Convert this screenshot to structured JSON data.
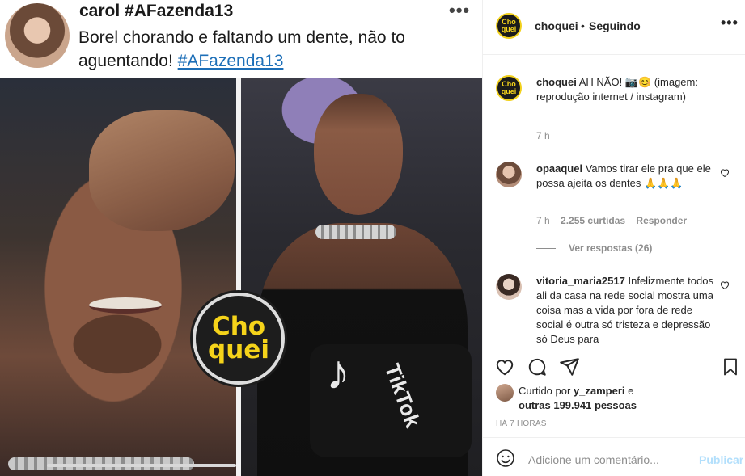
{
  "tweet": {
    "name": "carol #AFazenda13",
    "text": "Borel chorando e faltando um dente, não to aguentando!",
    "hashtag": "#AFazenda13",
    "more": "•••"
  },
  "media": {
    "logo_line1": "Cho",
    "logo_line2": "quei",
    "tiktok_word": "TikTok",
    "tiktok_mark": "♪",
    "video_progress": 1.0
  },
  "header": {
    "username": "choquei",
    "separator": "•",
    "follow_status": "Seguindo",
    "more": "•••",
    "avatar_line1": "Cho",
    "avatar_line2": "quei"
  },
  "caption": {
    "username": "choquei",
    "text": "AH NÃO! 📷😊 (imagem: reprodução internet / instagram)",
    "time": "7 h"
  },
  "comments": [
    {
      "username": "opaaquel",
      "text": "Vamos tirar ele pra que ele possa ajeita os dentes 🙏🙏🙏",
      "time": "7 h",
      "likes": "2.255 curtidas",
      "reply": "Responder",
      "view_replies": "Ver respostas (26)"
    },
    {
      "username": "vitoria_maria2517",
      "text": "Infelizmente todos ali da casa na rede social mostra uma coisa mas a vida por fora de rede social é outra só tristeza e depressão só Deus para"
    }
  ],
  "actions": {
    "like_icon": "heart-icon",
    "comment_icon": "comment-icon",
    "share_icon": "send-icon",
    "save_icon": "bookmark-icon"
  },
  "likes": {
    "prefix": "Curtido por",
    "user": "y_zamperi",
    "connector": "e",
    "others": "outras 199.941 pessoas"
  },
  "timestamp": "HÁ 7 HORAS",
  "add_comment": {
    "placeholder": "Adicione um comentário...",
    "publish": "Publicar"
  },
  "colors": {
    "logo_yellow": "#f5d31a",
    "link_blue": "#1d6fb8",
    "publish_disabled": "#b2dffc",
    "muted": "#8e8e8e"
  }
}
